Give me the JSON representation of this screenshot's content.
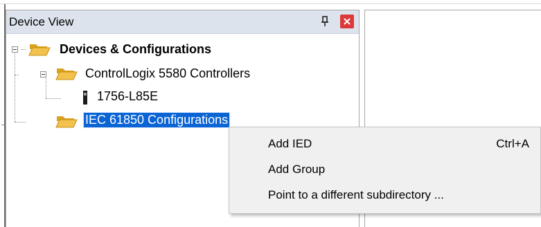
{
  "panel": {
    "title": "Device View"
  },
  "tree": {
    "root_label": "Devices & Configurations",
    "controllers_folder": "ControlLogix 5580 Controllers",
    "controller_item": "1756-L85E",
    "iec_folder": "IEC 61850 Configurations"
  },
  "context_menu": {
    "items": [
      {
        "label": "Add IED",
        "shortcut": "Ctrl+A"
      },
      {
        "label": "Add Group",
        "shortcut": ""
      },
      {
        "label": "Point to a different subdirectory ...",
        "shortcut": ""
      }
    ]
  },
  "colors": {
    "header_bg": "#dde3ec",
    "selection": "#0a64d4",
    "close_button": "#dc3a3a",
    "folder": "#f2c14e"
  }
}
